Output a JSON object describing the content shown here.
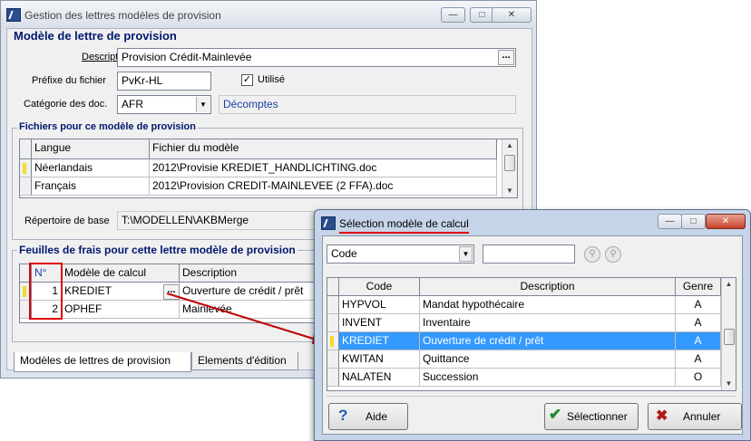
{
  "main_window": {
    "title": "Gestion des lettres modèles de provision",
    "group_title": "Modèle de lettre de provision",
    "description_label": "Description",
    "description_value": "Provision Crédit-Mainlevée",
    "prefix_label": "Préfixe du fichier",
    "prefix_value": "PvKr-HL",
    "used_label": "Utilisé",
    "category_label": "Catégorie des doc.",
    "category_value": "AFR",
    "category_name": "Décomptes",
    "files_group_title": "Fichiers pour ce modèle de provision",
    "files_columns": [
      "Langue",
      "Fichier du modèle"
    ],
    "files_rows": [
      {
        "langue": "Néerlandais",
        "fichier": "2012\\Provisie KREDIET_HANDLICHTING.doc"
      },
      {
        "langue": "Français",
        "fichier": "2012\\Provision CREDIT-MAINLEVEE (2 FFA).doc"
      }
    ],
    "base_dir_label": "Répertoire de base",
    "base_dir_value": "T:\\MODELLEN\\AKBMerge",
    "sheets_group_title": "Feuilles de frais pour cette lettre modèle de provision",
    "sheets_columns": [
      "N°",
      "Modèle de calcul",
      "Description"
    ],
    "sheets_rows": [
      {
        "no": "1",
        "model": "KREDIET",
        "description": "Ouverture de crédit / prêt"
      },
      {
        "no": "2",
        "model": "OPHEF",
        "description": "Mainlevée"
      }
    ],
    "tabs": [
      "Modèles de lettres de provision",
      "Elements d'édition"
    ]
  },
  "dialog": {
    "title": "Sélection modèle de calcul",
    "search_field": "Code",
    "columns": [
      "Code",
      "Description",
      "Genre"
    ],
    "rows": [
      {
        "code": "HYPVOL",
        "description": "Mandat hypothécaire",
        "genre": "A"
      },
      {
        "code": "INVENT",
        "description": "Inventaire",
        "genre": "A"
      },
      {
        "code": "KREDIET",
        "description": "Ouverture de crédit / prêt",
        "genre": "A"
      },
      {
        "code": "KWITAN",
        "description": "Quittance",
        "genre": "A"
      },
      {
        "code": "NALATEN",
        "description": "Succession",
        "genre": "O"
      }
    ],
    "help_label": "Aide",
    "select_label": "Sélectionner",
    "cancel_label": "Annuler"
  },
  "colors": {
    "accent_red": "#e00000",
    "selection_blue": "#3399ff",
    "group_title_blue": "#00186e"
  }
}
